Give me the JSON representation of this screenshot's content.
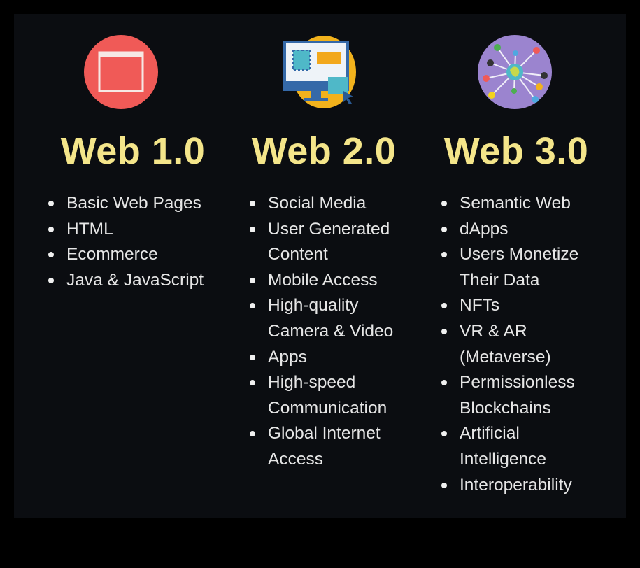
{
  "columns": [
    {
      "title": "Web 1.0",
      "icon": "browser-window-icon",
      "icon_color": "#f05a57",
      "items": [
        "Basic Web Pages",
        "HTML",
        "Ecommerce",
        "Java & JavaScript"
      ]
    },
    {
      "title": "Web 2.0",
      "icon": "computer-monitor-icon",
      "icon_color": "#f2b21c",
      "items": [
        "Social Media",
        "User Generated\nContent",
        "Mobile Access",
        "High-quality\nCamera & Video",
        "Apps",
        "High-speed\nCommunication",
        "Global Internet\nAccess"
      ]
    },
    {
      "title": "Web 3.0",
      "icon": "network-globe-icon",
      "icon_color": "#9b84cf",
      "items": [
        "Semantic Web",
        "dApps",
        "Users Monetize\nTheir Data",
        "NFTs",
        "VR & AR\n(Metaverse)",
        "Permissionless\nBlockchains",
        "Artificial\nIntelligence",
        "Interoperability"
      ]
    }
  ],
  "colors": {
    "title": "#f4e58a",
    "text": "#e6e6e6",
    "background": "#0b0d11"
  }
}
